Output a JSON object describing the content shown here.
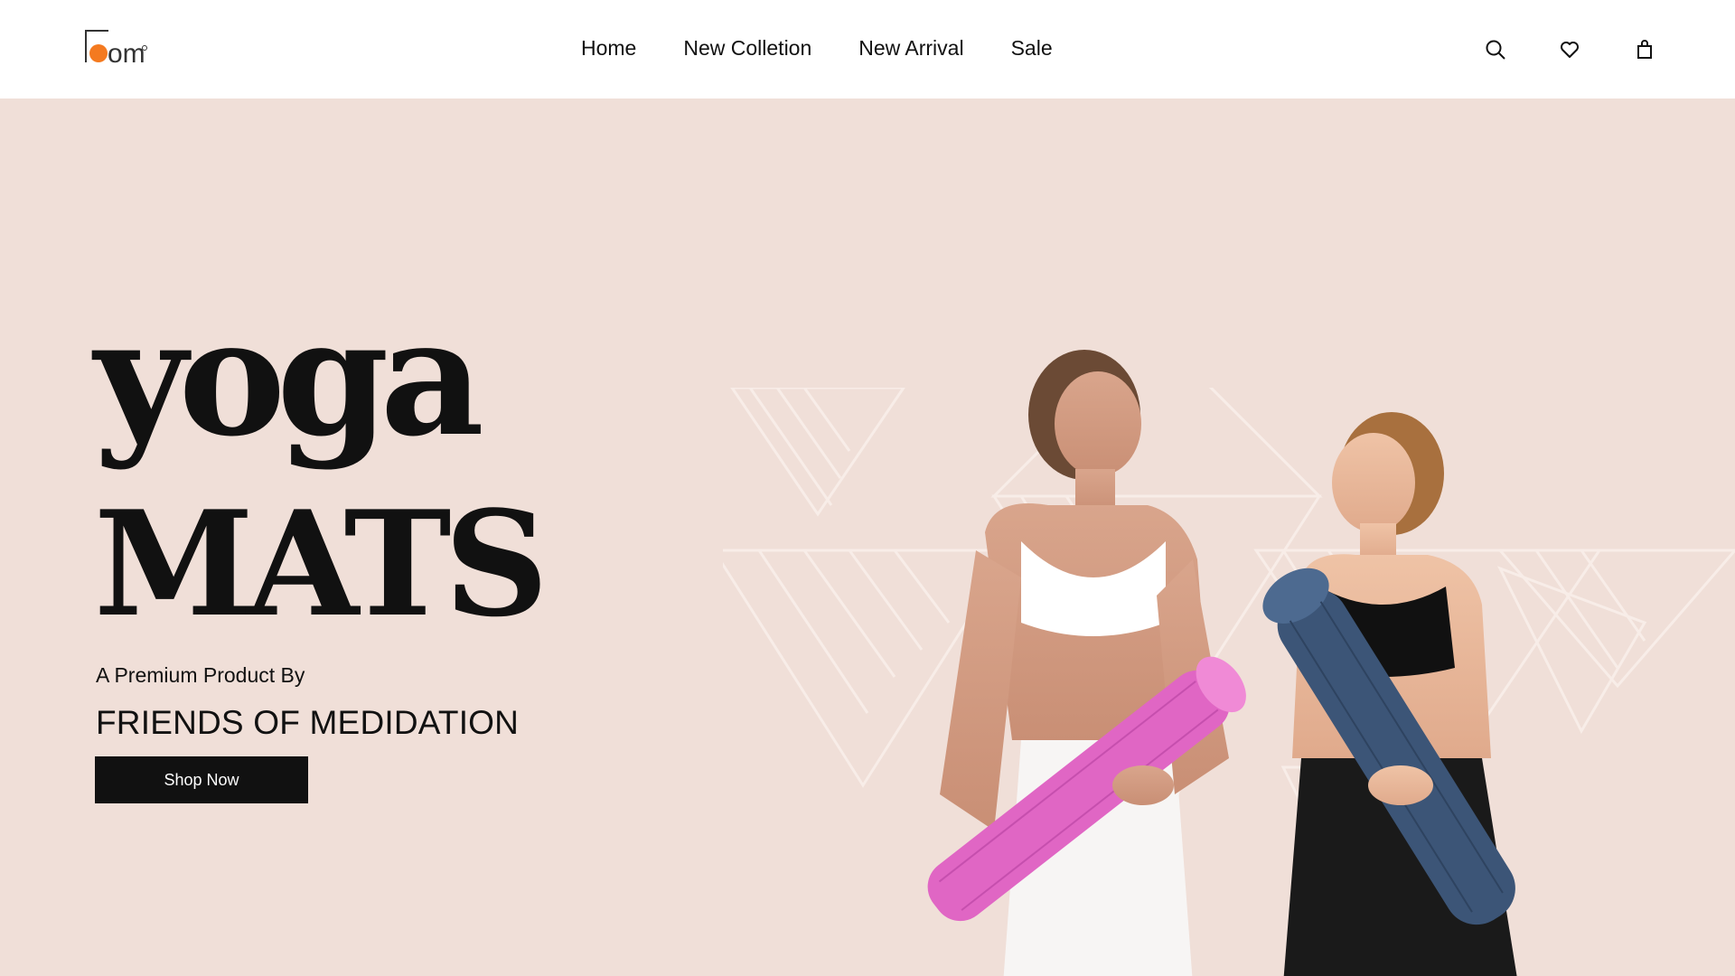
{
  "brand": {
    "logo_text": "om",
    "logo_accent": "#f47a20"
  },
  "nav": {
    "items": [
      "Home",
      "New Colletion",
      "New Arrival",
      "Sale"
    ]
  },
  "header_icons": [
    "search-icon",
    "heart-icon",
    "bag-icon"
  ],
  "hero": {
    "title_line1": "yoga",
    "title_line2": "MATS",
    "subtitle": "A Premium Product By",
    "brand_line": "FRIENDS OF MEDIDATION",
    "cta_label": "Shop Now"
  },
  "colors": {
    "hero_bg": "#f0dfd8",
    "header_bg": "#ffffff",
    "text": "#111111",
    "pink_mat": "#e066c4",
    "blue_mat": "#3c5577"
  }
}
